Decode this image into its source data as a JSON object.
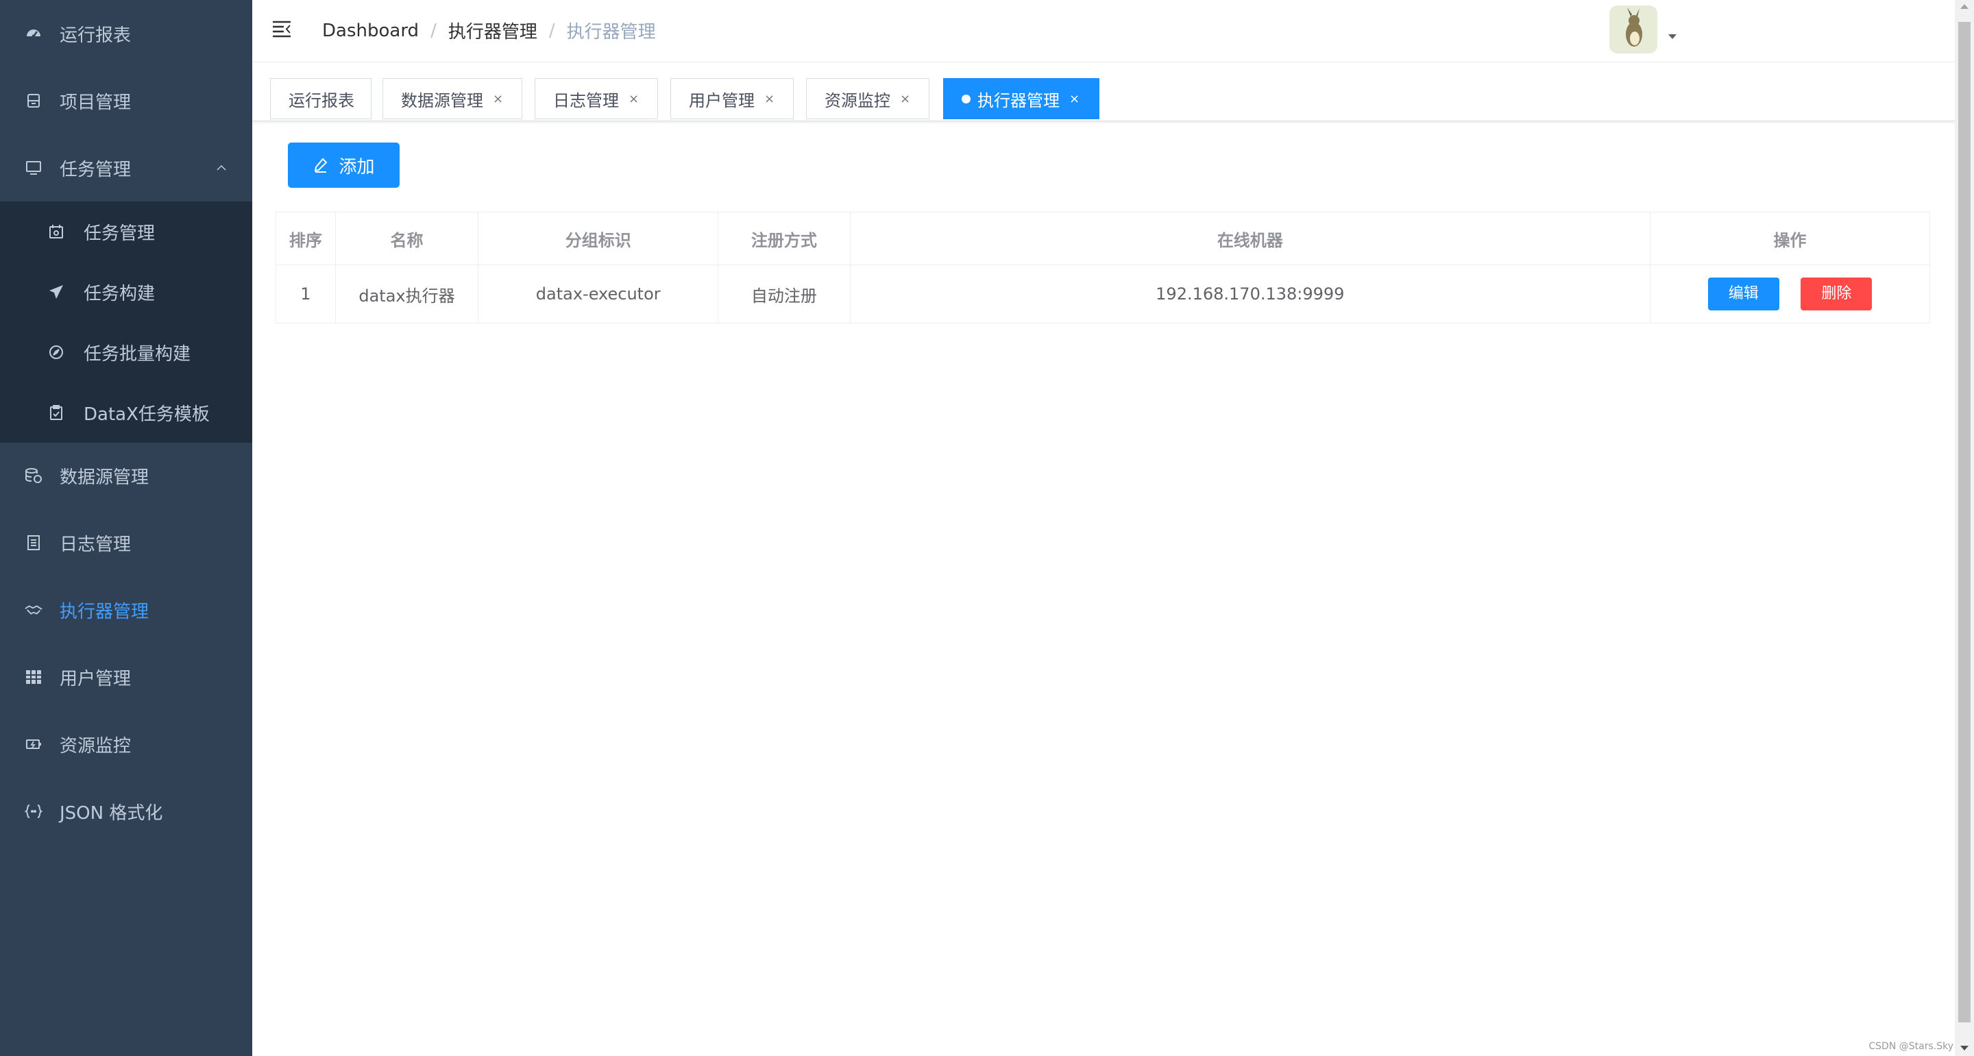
{
  "sidebar": {
    "items": [
      {
        "label": "运行报表",
        "icon": "dashboard-icon"
      },
      {
        "label": "项目管理",
        "icon": "database-icon"
      },
      {
        "label": "任务管理",
        "icon": "monitor-icon"
      },
      {
        "label": "数据源管理",
        "icon": "datasource-icon"
      },
      {
        "label": "日志管理",
        "icon": "document-icon"
      },
      {
        "label": "执行器管理",
        "icon": "handshake-icon"
      },
      {
        "label": "用户管理",
        "icon": "table-icon"
      },
      {
        "label": "资源监控",
        "icon": "battery-icon"
      },
      {
        "label": "JSON 格式化",
        "icon": "braces-icon"
      }
    ],
    "subitems": [
      {
        "label": "任务管理",
        "icon": "calendar-icon"
      },
      {
        "label": "任务构建",
        "icon": "paper-plane-icon"
      },
      {
        "label": "任务批量构建",
        "icon": "compass-icon"
      },
      {
        "label": "DataX任务模板",
        "icon": "clipboard-icon"
      }
    ]
  },
  "navbar": {
    "breadcrumb": [
      "Dashboard",
      "执行器管理",
      "执行器管理"
    ]
  },
  "tags": [
    {
      "label": "运行报表"
    },
    {
      "label": "数据源管理"
    },
    {
      "label": "日志管理"
    },
    {
      "label": "用户管理"
    },
    {
      "label": "资源监控"
    },
    {
      "label": "执行器管理"
    }
  ],
  "toolbar": {
    "add_label": "添加"
  },
  "table": {
    "headers": [
      "排序",
      "名称",
      "分组标识",
      "注册方式",
      "在线机器",
      "操作"
    ],
    "rows": [
      {
        "order": "1",
        "name": "datax执行器",
        "appname": "datax-executor",
        "register": "自动注册",
        "address": "192.168.170.138:9999"
      }
    ],
    "edit_label": "编辑",
    "delete_label": "删除"
  },
  "watermark": "CSDN @Stars.Sky",
  "colors": {
    "sidebar_bg": "#304156",
    "submenu_bg": "#1f2d3d",
    "active": "#409eff",
    "primary": "#1890ff",
    "danger": "#ff4949"
  }
}
